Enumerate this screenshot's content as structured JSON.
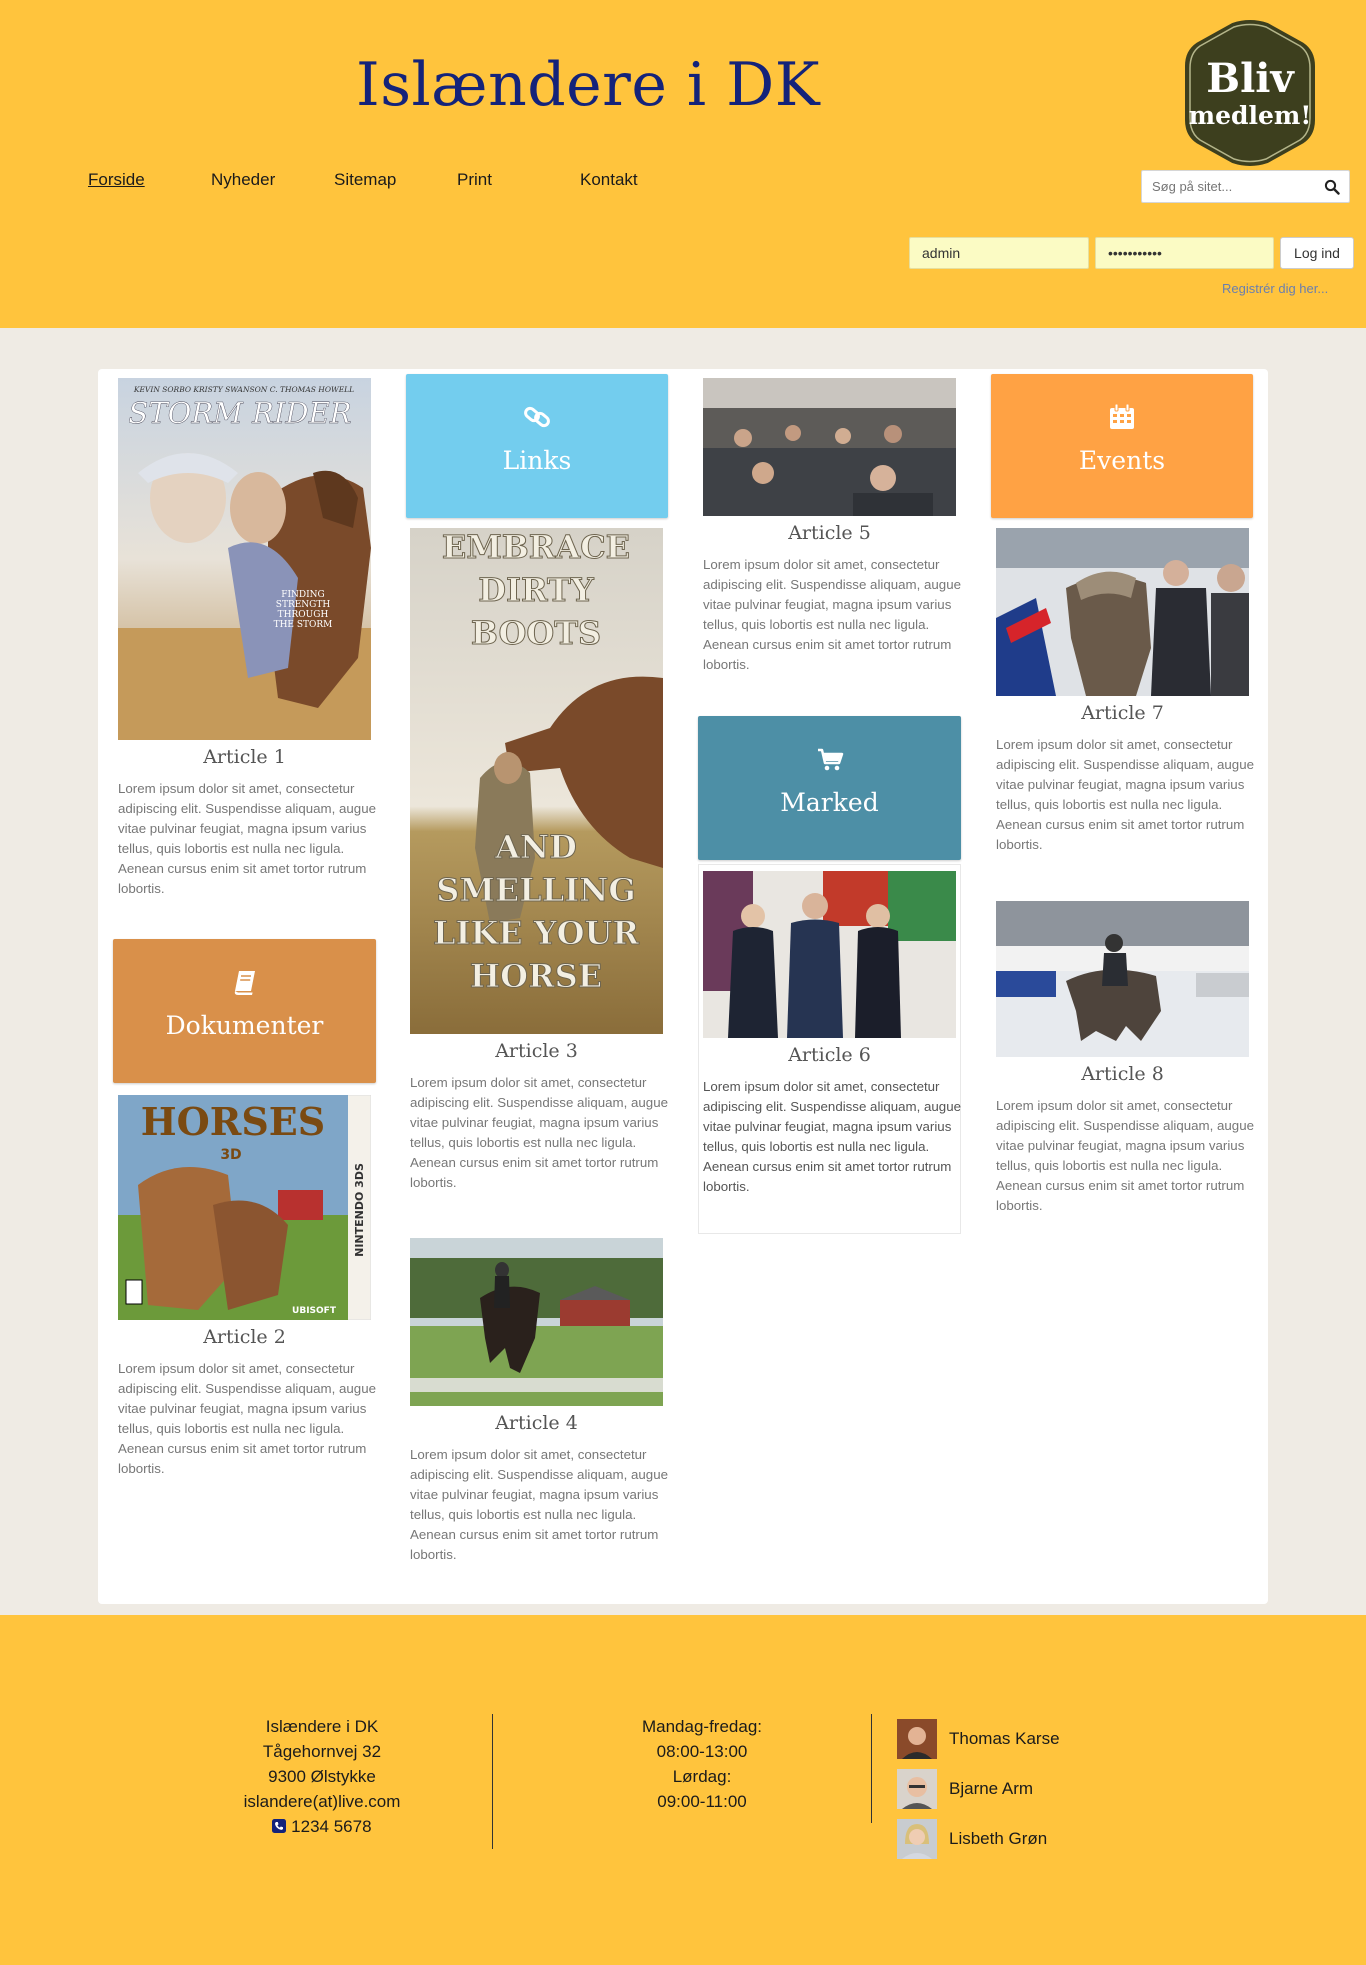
{
  "header": {
    "title": "Islændere i DK",
    "nav": [
      "Forside",
      "Nyheder",
      "Sitemap",
      "Print",
      "Kontakt"
    ],
    "join_badge": {
      "line1": "Bliv",
      "line2": "medlem!"
    },
    "search_placeholder": "Søg på sitet...",
    "login": {
      "username": "admin",
      "password": "•••••••••••",
      "button": "Log ind"
    },
    "register_link": "Registrér dig her..."
  },
  "lorem": "Lorem ipsum dolor sit amet, consectetur adipiscing elit. Suspendisse aliquam, augue vitae pulvinar feugiat, magna ipsum varius tellus, quis lobortis est nulla nec ligula. Aenean cursus enim sit amet tortor rutrum lobortis.",
  "articles": {
    "a1": {
      "title": "Article 1",
      "image_text": {
        "credits": "KEVIN SORBO   KRISTY SWANSON   C. THOMAS HOWELL",
        "title": "STORM RIDER",
        "tagline": "FINDING STRENGTH THROUGH THE STORM"
      }
    },
    "a2": {
      "title": "Article 2",
      "image_text": {
        "title": "HORSES",
        "sub": "3D",
        "platform": "NINTENDO 3DS",
        "publisher": "UBISOFT"
      }
    },
    "a3": {
      "title": "Article 3",
      "image_text": {
        "top": "EMBRACE DIRTY BOOTS",
        "bottom": "AND SMELLING LIKE YOUR HORSE"
      }
    },
    "a4": {
      "title": "Article 4"
    },
    "a5": {
      "title": "Article 5"
    },
    "a6": {
      "title": "Article 6"
    },
    "a7": {
      "title": "Article 7"
    },
    "a8": {
      "title": "Article 8"
    }
  },
  "tiles": {
    "links": {
      "label": "Links",
      "icon": "link-icon",
      "color": "#73cdee"
    },
    "events": {
      "label": "Events",
      "icon": "calendar-icon",
      "color": "#ffa244"
    },
    "marked": {
      "label": "Marked",
      "icon": "cart-icon",
      "color": "#4d8fa6"
    },
    "dokumenter": {
      "label": "Dokumenter",
      "icon": "book-icon",
      "color": "#d9904a"
    }
  },
  "footer": {
    "address": {
      "name": "Islændere i DK",
      "street": "Tågehornvej 32",
      "city": "9300 Ølstykke",
      "email": "islandere(at)live.com",
      "phone": "1234 5678"
    },
    "hours": {
      "weekday_label": "Mandag-fredag:",
      "weekday_hours": "08:00-13:00",
      "saturday_label": "Lørdag:",
      "saturday_hours": "09:00-11:00"
    },
    "people": [
      "Thomas Karse",
      "Bjarne Arm",
      "Lisbeth Grøn"
    ]
  },
  "colors": {
    "header_bg": "#ffc43d",
    "title": "#14237a",
    "page_bg": "#efebe4",
    "badge_bg": "#3d3f1e"
  }
}
